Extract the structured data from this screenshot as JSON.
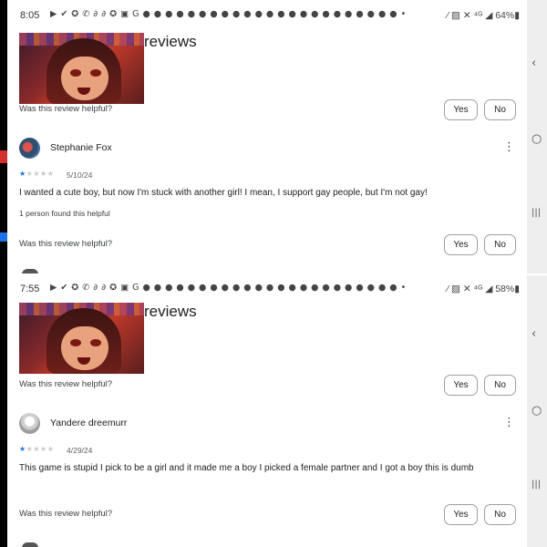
{
  "screens": [
    {
      "status": {
        "time": "8:05",
        "icons": "▶ ✔ ✪ ✆ ∂ ∂ ✪ ▣ G ● ● ● ● ● ● ● ● ● ● ● ● ● ● ● ● ● ● ● ● ● ● ● •",
        "right": "⁄ ▨ ✕ ⁴ᴳ ◢ 64%▮"
      },
      "section_title": "reviews",
      "prev_helpful": {
        "label": "Was this review helpful?",
        "yes": "Yes",
        "no": "No"
      },
      "review": {
        "reviewer": "Stephanie Fox",
        "rating": 1,
        "date": "5/10/24",
        "text": "I wanted a cute boy, but now I'm stuck with another girl! I mean, I support gay people, but I'm not gay!",
        "found_helpful": "1 person found this helpful",
        "helpful_label": "Was this review helpful?",
        "yes": "Yes",
        "no": "No"
      }
    },
    {
      "status": {
        "time": "7:55",
        "icons": "▶ ✔ ✪ ✆ ∂ ∂ ✪ ▣ G ● ● ● ● ● ● ● ● ● ● ● ● ● ● ● ● ● ● ● ● ● ● ● •",
        "right": "⁄ ▨ ✕ ⁴ᴳ ◢ 58%▮"
      },
      "section_title": "reviews",
      "prev_helpful": {
        "label": "Was this review helpful?",
        "yes": "Yes",
        "no": "No"
      },
      "review": {
        "reviewer": "Yandere dreemurr",
        "rating": 1,
        "date": "4/29/24",
        "text": "This game is stupid I pick to be a girl and it made me a boy I picked a female partner and I got a boy this is dumb",
        "helpful_label": "Was this review helpful?",
        "yes": "Yes",
        "no": "No"
      }
    }
  ],
  "icons": {
    "kebab": "more-vert-icon",
    "star_filled": "★",
    "star_empty": "★",
    "nav_back": "‹",
    "nav_home": "○",
    "nav_recents": "|||"
  },
  "colors": {
    "star": "#1a73e8",
    "star_empty": "#c8c8c8",
    "button_border": "#9aa0a6"
  }
}
